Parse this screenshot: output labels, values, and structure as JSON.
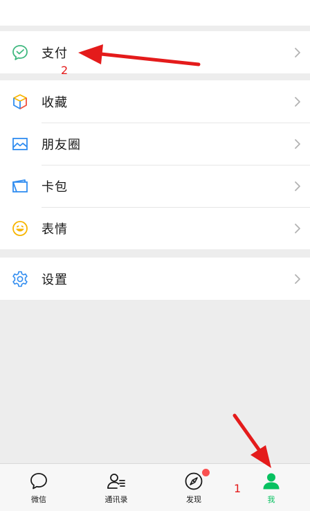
{
  "menu": {
    "pay": {
      "label": "支付",
      "icon": "wechat-pay-icon"
    },
    "favorites": {
      "label": "收藏",
      "icon": "cube-icon"
    },
    "moments": {
      "label": "朋友圈",
      "icon": "image-icon"
    },
    "cards": {
      "label": "卡包",
      "icon": "wallet-icon"
    },
    "stickers": {
      "label": "表情",
      "icon": "smiley-icon"
    },
    "settings": {
      "label": "设置",
      "icon": "gear-icon"
    }
  },
  "tabs": [
    {
      "label": "微信",
      "icon": "chat-bubble-icon"
    },
    {
      "label": "通讯录",
      "icon": "contacts-icon"
    },
    {
      "label": "发现",
      "icon": "compass-icon"
    },
    {
      "label": "我",
      "icon": "person-icon"
    }
  ],
  "annotations": {
    "pay_step": "2",
    "me_step": "1"
  },
  "colors": {
    "accent": "#07c160",
    "badge": "#fa5151",
    "annotation": "#e41b1b",
    "background": "#ededed"
  }
}
